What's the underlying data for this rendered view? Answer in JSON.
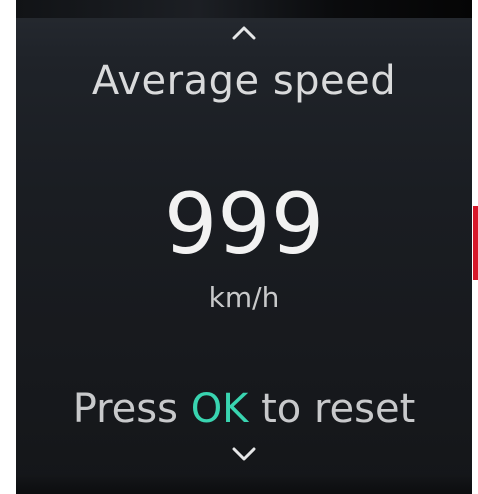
{
  "screen": {
    "title": "Average speed",
    "value": "999",
    "unit": "km/h",
    "hint": {
      "before": "Press ",
      "key": "OK",
      "after": " to reset"
    }
  },
  "icons": {
    "up": "chevron-up-icon",
    "down": "chevron-down-icon"
  },
  "colors": {
    "background": "#1a1d22",
    "text": "#d9dadb",
    "accent_key": "#39d4b0",
    "indicator": "#d7182a"
  }
}
